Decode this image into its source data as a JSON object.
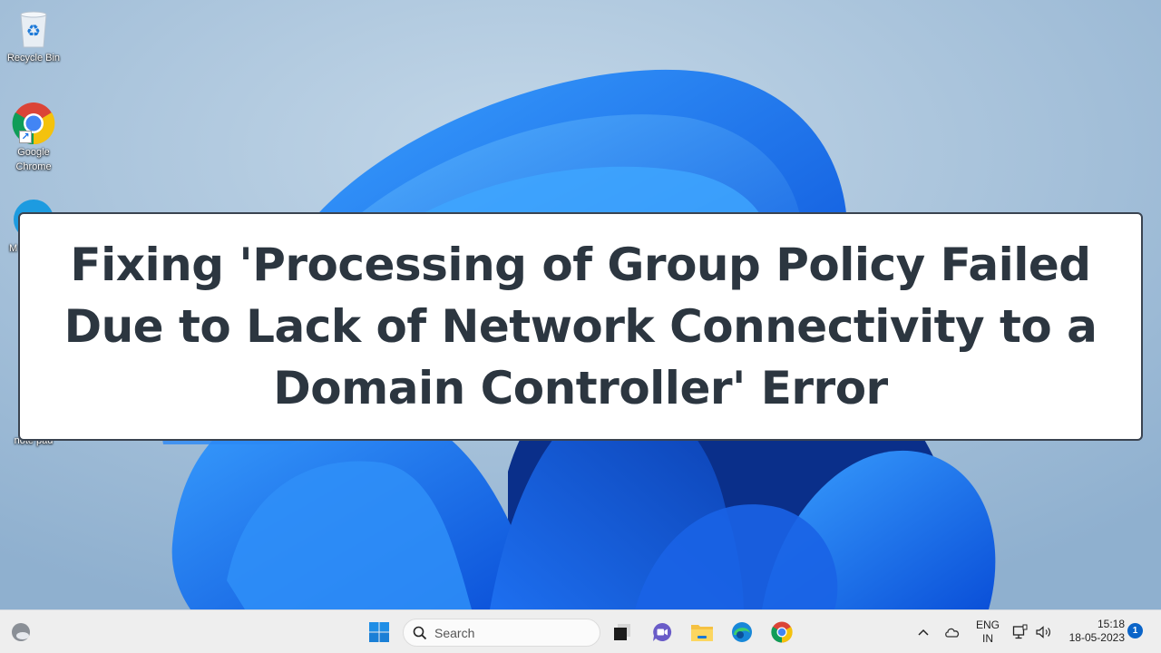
{
  "desktop": {
    "icons": [
      {
        "label": "Recycle Bin",
        "icon": "recycle-bin-icon"
      },
      {
        "label": "Google Chrome",
        "icon": "chrome-icon"
      },
      {
        "label": "M",
        "icon": "edge-icon"
      },
      {
        "label": "note pad",
        "icon": "onedrive-icon"
      }
    ]
  },
  "banner": {
    "lines": [
      "Fixing 'Processing of Group Policy Failed",
      "Due to Lack of Network Connectivity to a",
      "Domain Controller' Error"
    ],
    "text_color": "#2c3640",
    "border_color": "#3a4350"
  },
  "taskbar": {
    "widgets_icon": "weather-widget-icon",
    "start_icon": "windows-start-icon",
    "search": {
      "placeholder": "Search"
    },
    "pinned": [
      {
        "name": "task-view",
        "icon": "task-view-icon"
      },
      {
        "name": "teams-chat",
        "icon": "teams-chat-icon"
      },
      {
        "name": "file-explorer",
        "icon": "file-explorer-icon"
      },
      {
        "name": "edge",
        "icon": "edge-icon"
      },
      {
        "name": "chrome",
        "icon": "chrome-icon"
      }
    ],
    "tray": {
      "language_top": "ENG",
      "language_bottom": "IN",
      "time": "15:18",
      "date": "18-05-2023",
      "notification_count": "1"
    },
    "accent_color": "#0a64c8"
  }
}
